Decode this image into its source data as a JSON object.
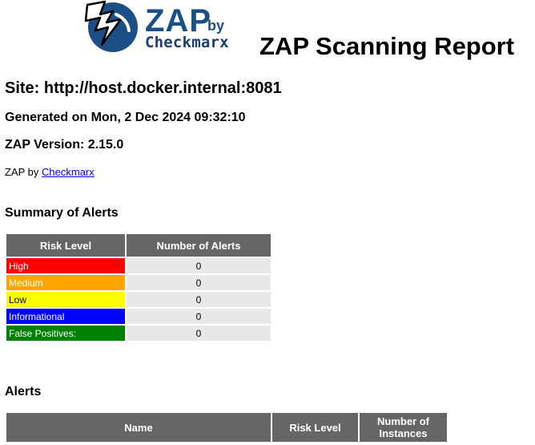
{
  "logo": {
    "brand": "ZAP",
    "by": "by",
    "company": "Checkmarx",
    "accent_color": "#1b4f86"
  },
  "report": {
    "title": "ZAP Scanning Report",
    "site": "Site: http://host.docker.internal:8081",
    "generated": "Generated on Mon, 2 Dec 2024 09:32:10",
    "version": "ZAP Version: 2.15.0",
    "byline_prefix": "ZAP by ",
    "byline_link": "Checkmarx"
  },
  "summary": {
    "heading": "Summary of Alerts",
    "columns": [
      "Risk Level",
      "Number of Alerts"
    ],
    "rows": [
      {
        "risk": "High",
        "count": "0",
        "color": "#ff0000"
      },
      {
        "risk": "Medium",
        "count": "0",
        "color": "#ffa500"
      },
      {
        "risk": "Low",
        "count": "0",
        "color": "#ffff00"
      },
      {
        "risk": "Informational",
        "count": "0",
        "color": "#0000ff"
      },
      {
        "risk": "False Positives:",
        "count": "0",
        "color": "#008000"
      }
    ]
  },
  "alerts": {
    "heading": "Alerts",
    "columns": [
      "Name",
      "Risk Level",
      "Number of Instances"
    ]
  }
}
